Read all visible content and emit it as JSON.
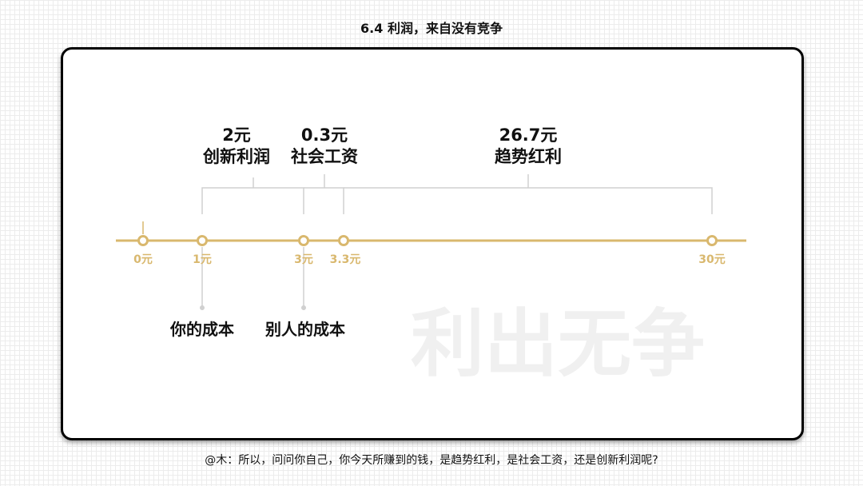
{
  "header": {
    "title": "6.4   利润，来自没有竞争"
  },
  "footer": {
    "caption": "@木：所以，问问你自己，你今天所赚到的钱，是趋势红利，是社会工资，还是创新利润呢?"
  },
  "watermark": {
    "text": "利出无争"
  },
  "colors": {
    "axis": "#d9b86e",
    "bracket": "#d0d0d0",
    "watermark": "#f0f0f0",
    "text": "#111111"
  },
  "timeline": {
    "ticks": [
      {
        "value": 0,
        "label": "0元"
      },
      {
        "value": 1,
        "label": "1元"
      },
      {
        "value": 3,
        "label": "3元"
      },
      {
        "value": 3.3,
        "label": "3.3元"
      },
      {
        "value": 30,
        "label": "30元"
      }
    ],
    "segments": [
      {
        "amount": "2元",
        "name": "创新利润"
      },
      {
        "amount": "0.3元",
        "name": "社会工资"
      },
      {
        "amount": "26.7元",
        "name": "趋势红利"
      }
    ],
    "costs": [
      {
        "label": "你的成本"
      },
      {
        "label": "别人的成本"
      }
    ]
  }
}
